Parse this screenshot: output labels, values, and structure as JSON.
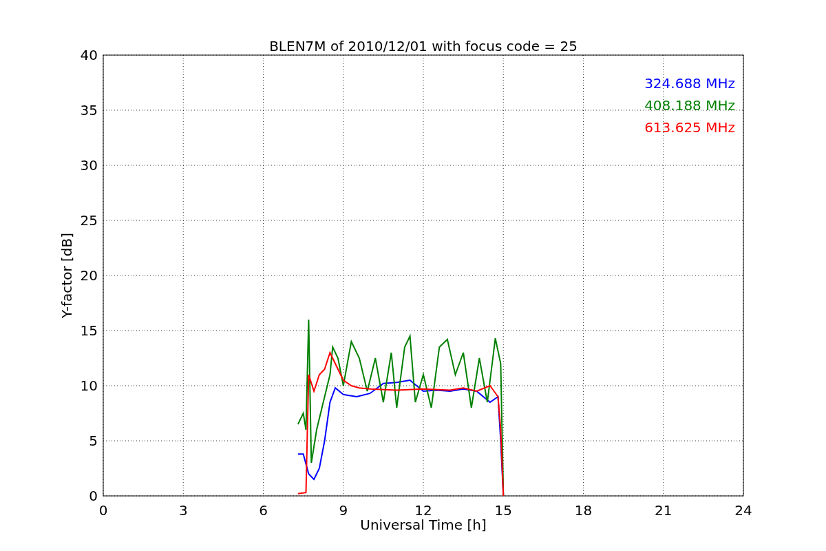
{
  "chart_data": {
    "type": "line",
    "title": "BLEN7M of 2010/12/01 with focus code = 25",
    "xlabel": "Universal Time [h]",
    "ylabel": "Y-factor [dB]",
    "xlim": [
      0,
      24
    ],
    "ylim": [
      0,
      40
    ],
    "xticks": [
      0,
      3,
      6,
      9,
      12,
      15,
      18,
      21,
      24
    ],
    "yticks": [
      0,
      5,
      10,
      15,
      20,
      25,
      30,
      35,
      40
    ],
    "grid": true,
    "series": [
      {
        "name": "324.688 MHz",
        "color": "#0000ff",
        "x": [
          7.3,
          7.5,
          7.7,
          7.9,
          8.1,
          8.3,
          8.5,
          8.7,
          9,
          9.5,
          10,
          10.5,
          11,
          11.5,
          12,
          12.5,
          13,
          13.5,
          14,
          14.5,
          14.8,
          14.9,
          15
        ],
        "values": [
          3.8,
          3.8,
          2,
          1.5,
          2.5,
          5,
          8.5,
          9.8,
          9.2,
          9,
          9.3,
          10.2,
          10.3,
          10.5,
          9.5,
          9.6,
          9.5,
          9.7,
          9.5,
          8.5,
          9,
          5,
          0
        ]
      },
      {
        "name": "408.188 MHz",
        "color": "#008000",
        "x": [
          7.3,
          7.5,
          7.6,
          7.7,
          7.8,
          8,
          8.2,
          8.5,
          8.6,
          8.8,
          9,
          9.3,
          9.6,
          9.9,
          10.2,
          10.5,
          10.8,
          11,
          11.3,
          11.5,
          11.7,
          12,
          12.3,
          12.6,
          12.9,
          13.2,
          13.5,
          13.8,
          14.1,
          14.4,
          14.7,
          14.9,
          15
        ],
        "values": [
          6.5,
          7.5,
          6,
          16,
          3,
          6,
          8,
          11,
          13.5,
          12.5,
          10,
          14,
          12.5,
          9.5,
          12.5,
          8.5,
          13,
          8,
          13.5,
          14.5,
          8.5,
          11,
          8,
          13.5,
          14.2,
          11,
          13,
          8,
          12.5,
          8.5,
          14.3,
          12,
          0
        ]
      },
      {
        "name": "613.625 MHz",
        "color": "#ff0000",
        "x": [
          7.3,
          7.6,
          7.7,
          7.9,
          8.1,
          8.3,
          8.5,
          8.7,
          9,
          9.3,
          9.6,
          10,
          11,
          12,
          13,
          13.5,
          14,
          14.5,
          14.8,
          14.9,
          15
        ],
        "values": [
          0.2,
          0.3,
          11,
          9.5,
          11,
          11.5,
          13,
          12,
          10.5,
          10,
          9.8,
          9.7,
          9.6,
          9.7,
          9.6,
          9.8,
          9.5,
          10,
          9,
          6,
          0
        ]
      }
    ]
  }
}
